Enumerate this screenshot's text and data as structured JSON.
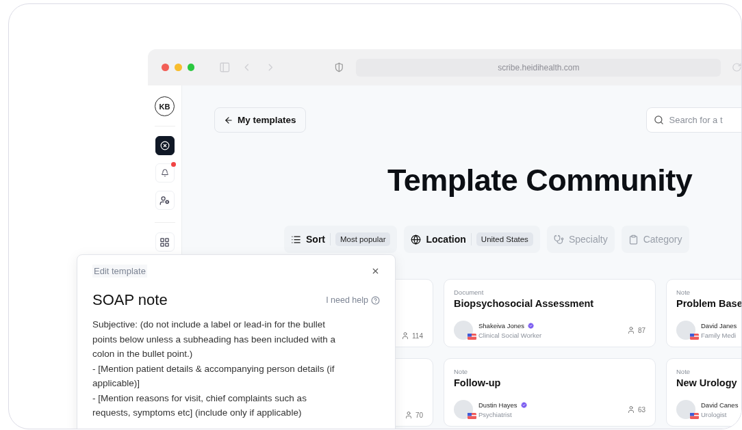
{
  "browser": {
    "url": "scribe.heidihealth.com"
  },
  "sidebar": {
    "avatar": "KB",
    "items": [
      {
        "kind": "logo",
        "selected": true,
        "notification": false
      },
      {
        "kind": "bell",
        "selected": false,
        "notification": true
      },
      {
        "kind": "user",
        "selected": false,
        "notification": false
      },
      {
        "kind": "apps",
        "selected": false,
        "notification": false
      }
    ]
  },
  "header": {
    "back_button": "My templates",
    "search": {
      "placeholder": "Search for a t"
    }
  },
  "title": "Template Community",
  "filters": [
    {
      "kind": "sort",
      "label": "Sort",
      "value": "Most popular",
      "active": true
    },
    {
      "kind": "location",
      "label": "Location",
      "value": "United States",
      "active": true
    },
    {
      "kind": "specialty",
      "label": "Specialty",
      "active": false
    },
    {
      "kind": "category",
      "label": "Category",
      "active": false
    }
  ],
  "cards": [
    {
      "count": "114"
    },
    {
      "type": "Document",
      "title": "Biopsychosocial Assessment",
      "author": "Shakeiva Jones",
      "verified": true,
      "role": "Clinical Social Worker",
      "count": "87"
    },
    {
      "type": "Note",
      "title": "Problem Base",
      "author": "David Janes",
      "verified": false,
      "role": "Family Medi"
    },
    {
      "count": "70"
    },
    {
      "type": "Note",
      "title": "Follow-up",
      "author": "Dustin Hayes",
      "verified": true,
      "role": "Psychiatrist",
      "count": "63"
    },
    {
      "type": "Note",
      "title": "New Urology",
      "author": "David Canes",
      "verified": false,
      "role": "Urologist"
    }
  ],
  "editor": {
    "label": "Edit template",
    "title": "SOAP note",
    "help": "I need help",
    "lines": [
      "Subjective: (do not include a label or lead-in for the bullet points below unless a subheading has been included with a colon in the bullet point.)",
      "- [Mention patient details & accompanying person details (if applicable)]",
      "- [Mention reasons for visit, chief complaints such as requests, symptoms etc] (include only if applicable)"
    ]
  }
}
